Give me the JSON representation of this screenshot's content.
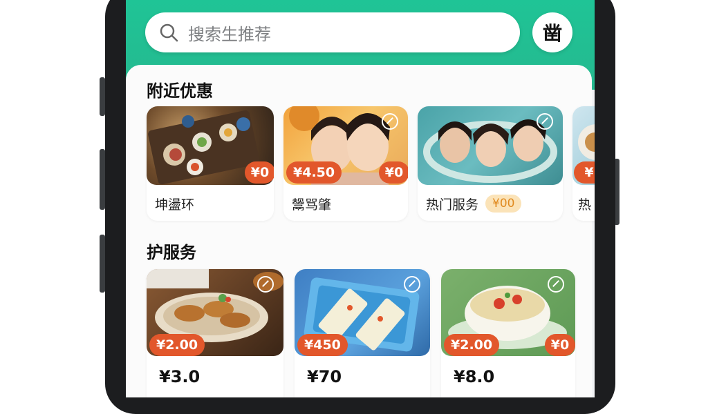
{
  "search": {
    "placeholder_text": "搜索生推荐"
  },
  "scan_button": {
    "icon": "scan-icon",
    "glyph": "凿"
  },
  "sections": [
    {
      "title": "附近优惠",
      "cards": [
        {
          "label": "坤盪环",
          "badge_right": "¥0"
        },
        {
          "label": "鬶骂肇",
          "badge_left": "¥4.50",
          "badge_right": "¥0"
        },
        {
          "label": "热门服务",
          "tag": "¥00"
        },
        {
          "label": "热",
          "badge_right": "¥"
        }
      ]
    },
    {
      "title": "护服务",
      "cards": [
        {
          "badge_left": "¥2.00",
          "price": "¥3.0"
        },
        {
          "badge_left": "¥450",
          "price": "¥70"
        },
        {
          "badge_left": "¥2.00",
          "badge_right": "¥0",
          "price": "¥8.0"
        }
      ]
    }
  ],
  "colors": {
    "brand": "#1fc496",
    "badge": "#e2572b",
    "tag_bg": "#fbe3b8",
    "tag_text": "#e08a1f"
  }
}
